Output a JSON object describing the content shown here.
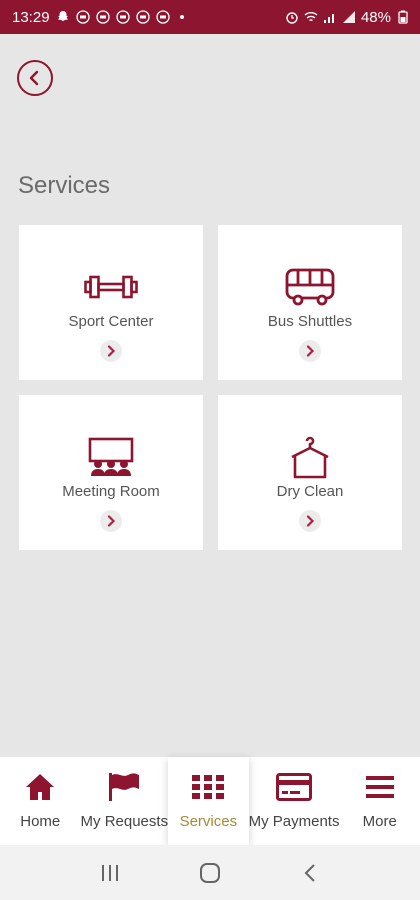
{
  "status_bar": {
    "time": "13:29",
    "battery": "48%"
  },
  "page": {
    "title": "Services"
  },
  "services": [
    {
      "label": "Sport Center",
      "icon": "dumbbell-icon"
    },
    {
      "label": "Bus Shuttles",
      "icon": "bus-icon"
    },
    {
      "label": "Meeting Room",
      "icon": "meeting-room-icon"
    },
    {
      "label": "Dry Clean",
      "icon": "hanger-icon"
    }
  ],
  "bottom_nav": {
    "items": [
      {
        "label": "Home",
        "icon": "home-icon"
      },
      {
        "label": "My Requests",
        "icon": "flag-icon"
      },
      {
        "label": "Services",
        "icon": "grid-icon",
        "active": true
      },
      {
        "label": "My Payments",
        "icon": "card-icon"
      },
      {
        "label": "More",
        "icon": "menu-icon"
      }
    ]
  },
  "colors": {
    "brand": "#8d1530",
    "active_label": "#a58a38",
    "background": "#e6e6e6"
  }
}
